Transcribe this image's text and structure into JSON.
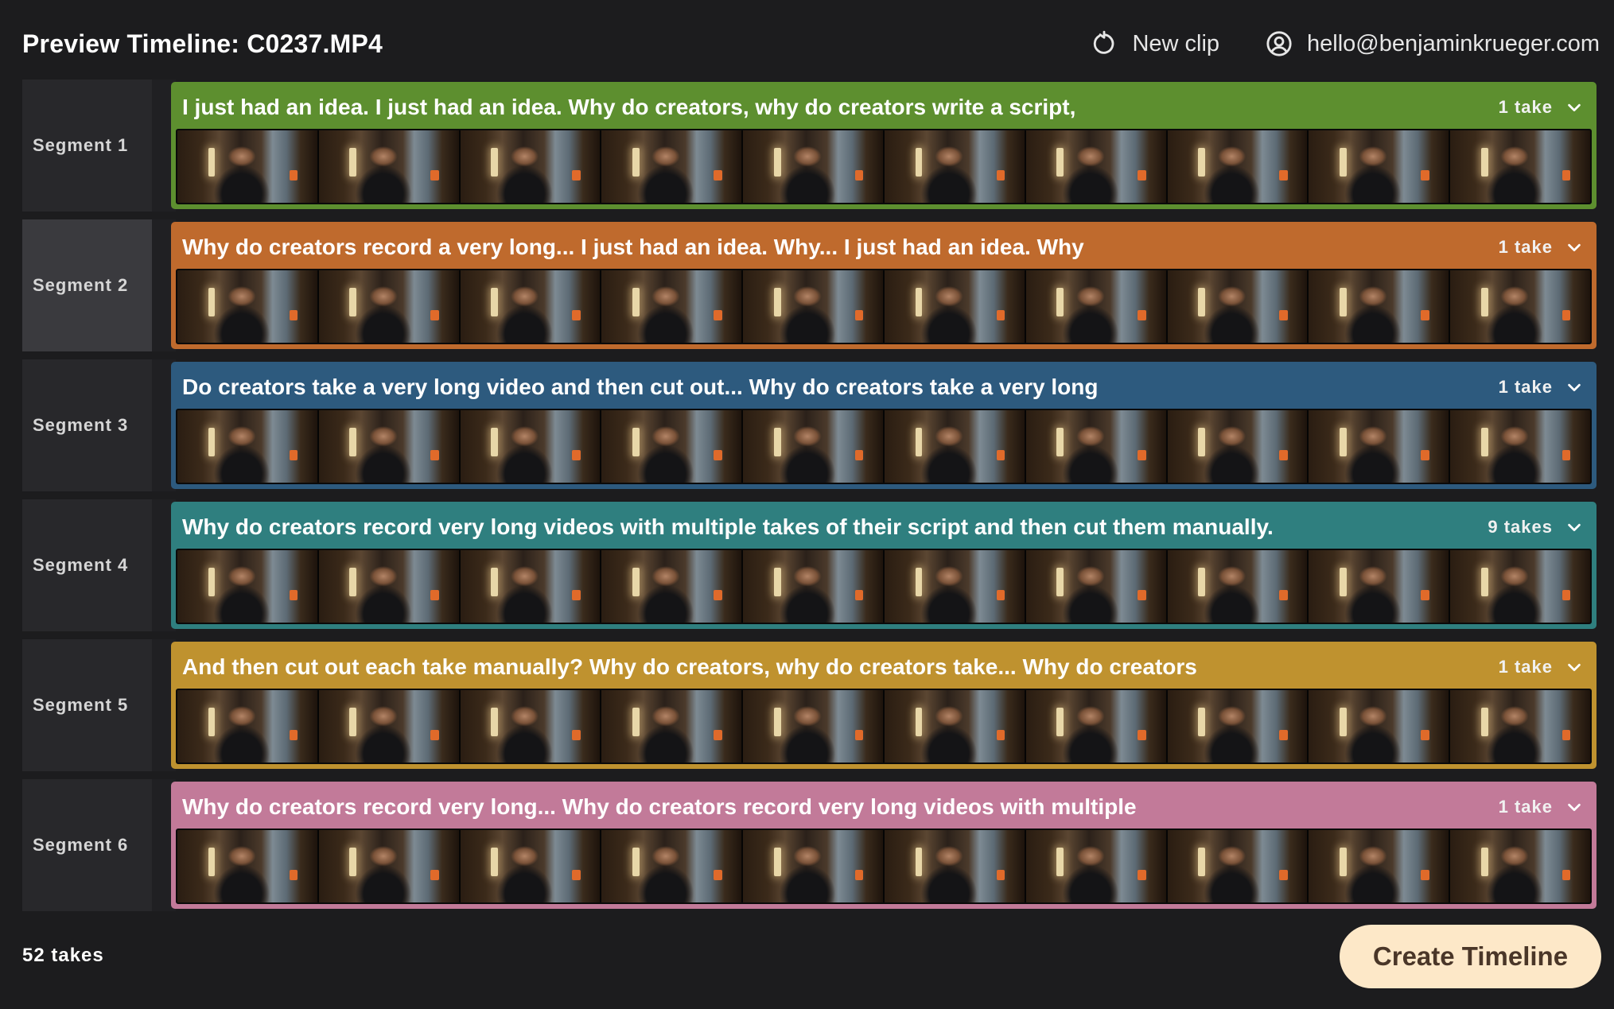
{
  "header": {
    "title": "Preview Timeline: C0237.MP4",
    "new_clip_label": "New clip",
    "new_clip_icon": "refresh-icon",
    "account_label": "hello@benjaminkrueger.com",
    "account_icon": "user-circle-icon"
  },
  "segments": [
    {
      "label": "Segment 1",
      "text": "I just had an idea. I just had an idea. Why do creators, why do creators write a script,",
      "takes": "1 take",
      "color": "#5d8f2f"
    },
    {
      "label": "Segment 2",
      "text": "Why do creators record a very long... I just had an idea. Why... I just had an idea. Why",
      "takes": "1 take",
      "color": "#bf6a2d"
    },
    {
      "label": "Segment 3",
      "text": "Do creators take a very long video and then cut out... Why do creators take a very long",
      "takes": "1 take",
      "color": "#2d5a7e"
    },
    {
      "label": "Segment 4",
      "text": "Why do creators record very long videos with multiple takes of their script and then cut them manually.",
      "takes": "9 takes",
      "color": "#2f7f7f"
    },
    {
      "label": "Segment 5",
      "text": "And then cut out each take manually? Why do creators, why do creators take... Why do creators",
      "takes": "1 take",
      "color": "#bf922f"
    },
    {
      "label": "Segment 6",
      "text": "Why do creators record very long... Why do creators record very long videos with multiple",
      "takes": "1 take",
      "color": "#c27a99"
    }
  ],
  "active_segment": "Segment 2",
  "footer": {
    "total_takes": "52 takes",
    "create_button_label": "Create Timeline"
  }
}
